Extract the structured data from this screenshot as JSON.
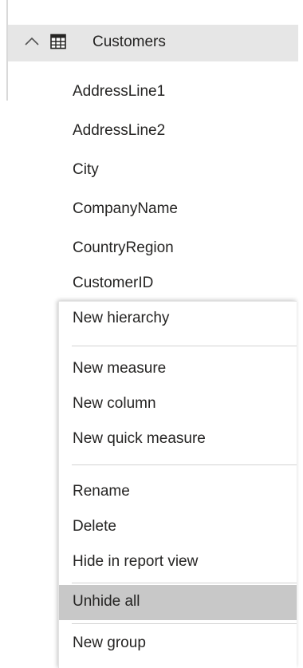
{
  "table": {
    "name": "Customers",
    "expanded": true,
    "chevron_icon": "chevron-up-icon",
    "table_icon": "table-grid-icon"
  },
  "fields": [
    "AddressLine1",
    "AddressLine2",
    "City",
    "CompanyName",
    "CountryRegion",
    "CustomerID"
  ],
  "context_menu": {
    "groups": [
      [
        "New hierarchy"
      ],
      [
        "New measure",
        "New column",
        "New quick measure"
      ],
      [
        "Rename",
        "Delete",
        "Hide in report view"
      ],
      [
        "Unhide all"
      ],
      [
        "New group"
      ]
    ],
    "highlighted_item": "Unhide all"
  }
}
